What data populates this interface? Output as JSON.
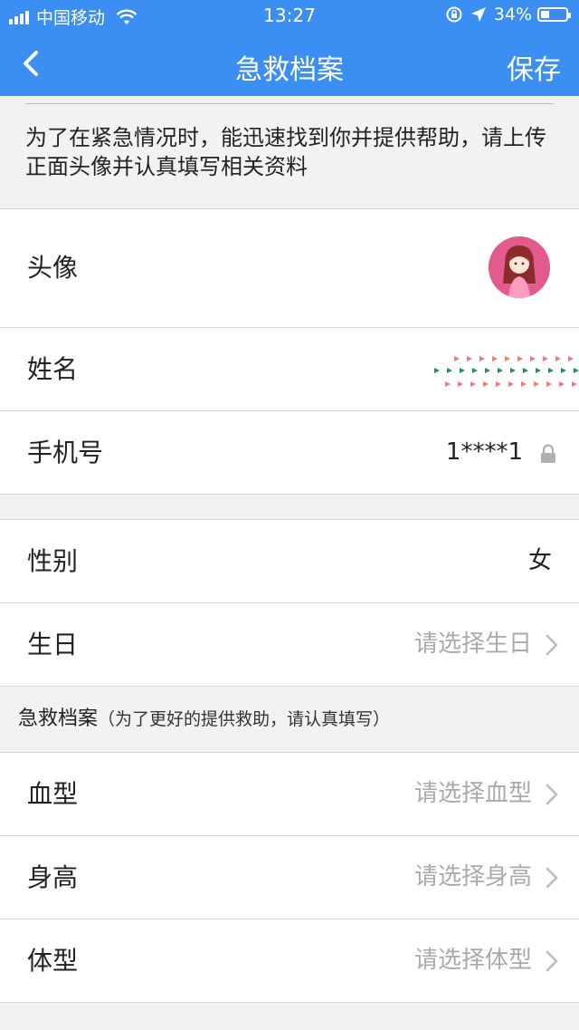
{
  "status_bar": {
    "carrier": "中国移动",
    "time": "13:27",
    "battery": "34%"
  },
  "nav": {
    "title": "急救档案",
    "save_label": "保存"
  },
  "notice": {
    "text": "为了在紧急情况时，能迅速找到你并提供帮助，请上传正面头像并认真填写相关资料"
  },
  "profile": {
    "avatar_label": "头像",
    "name_label": "姓名",
    "phone_label": "手机号",
    "phone_value": "1****1"
  },
  "basic": {
    "gender_label": "性别",
    "gender_value": "女",
    "birthday_label": "生日",
    "birthday_placeholder": "请选择生日"
  },
  "emergency_section": {
    "title": "急救档案",
    "subtitle": "（为了更好的提供救助，请认真填写）"
  },
  "emergency": {
    "blood_label": "血型",
    "blood_placeholder": "请选择血型",
    "height_label": "身高",
    "height_placeholder": "请选择身高",
    "body_label": "体型",
    "body_placeholder": "请选择体型"
  },
  "colors": {
    "accent": "#3b8ff2",
    "background": "#f2f2f2",
    "placeholder": "#aaaaaa",
    "avatar_bg": "#e25b8c"
  },
  "icons": [
    "signal-icon",
    "wifi-icon",
    "lock-rotation-icon",
    "location-arrow-icon",
    "battery-icon",
    "back-chevron-icon",
    "lock-icon",
    "chevron-right-icon"
  ]
}
